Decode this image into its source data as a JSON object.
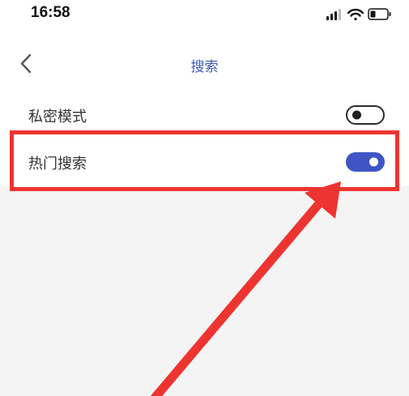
{
  "status_bar": {
    "time": "16:58",
    "icons": [
      "cellular-signal-icon",
      "wifi-icon",
      "battery-icon"
    ]
  },
  "nav": {
    "back_icon": "chevron-left-icon",
    "title": "搜索"
  },
  "settings": [
    {
      "label": "私密模式",
      "enabled": false
    },
    {
      "label": "热门搜索",
      "enabled": true
    }
  ],
  "colors": {
    "accent": "#3f55c6",
    "title": "#3d5bb8",
    "annotation": "#ee3430",
    "background": "#f4f4f4"
  }
}
